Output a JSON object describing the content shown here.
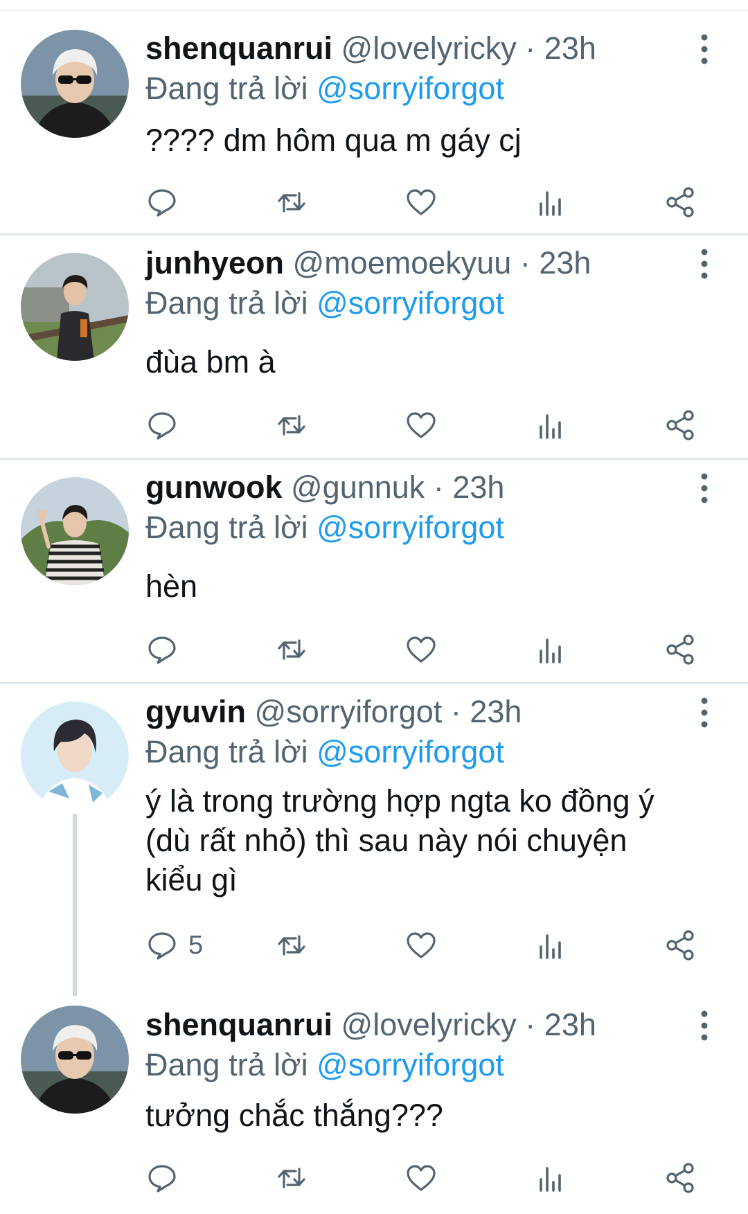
{
  "colors": {
    "text": "#0f1419",
    "secondary": "#536471",
    "accent": "#1d9bf0",
    "divider": "#e1e8ed"
  },
  "replies": [
    {
      "display_name": "shenquanrui",
      "handle": "@lovelyricky",
      "separator": "·",
      "time": "23h",
      "replying_label": "Đang trả lời",
      "replying_to": "@sorryiforgot",
      "text": "???? dm hôm qua m gáy cj",
      "reply_count": "",
      "avatar": "avatar-white-hair-sunglasses"
    },
    {
      "display_name": "junhyeon",
      "handle": "@moemoekyuu",
      "separator": "·",
      "time": "23h",
      "replying_label": "Đang trả lời",
      "replying_to": "@sorryiforgot",
      "text": "đùa bm à",
      "reply_count": "",
      "avatar": "avatar-outdoor-jacket"
    },
    {
      "display_name": "gunwook",
      "handle": "@gunnuk",
      "separator": "·",
      "time": "23h",
      "replying_label": "Đang trả lời",
      "replying_to": "@sorryiforgot",
      "text": "hèn",
      "reply_count": "",
      "avatar": "avatar-striped-sweater-peace-sign"
    },
    {
      "display_name": "gyuvin",
      "handle": "@sorryiforgot",
      "separator": "·",
      "time": "23h",
      "replying_label": "Đang trả lời",
      "replying_to": "@sorryiforgot",
      "text": "ý là trong trường hợp ngta ko đồng ý (dù rất nhỏ) thì sau này nói chuyện kiểu gì",
      "reply_count": "5",
      "avatar": "avatar-light-blue-portrait"
    },
    {
      "display_name": "shenquanrui",
      "handle": "@lovelyricky",
      "separator": "·",
      "time": "23h",
      "replying_label": "Đang trả lời",
      "replying_to": "@sorryiforgot",
      "text": "tưởng chắc thắng???",
      "reply_count": "",
      "avatar": "avatar-white-hair-sunglasses"
    }
  ],
  "icons": {
    "reply": "reply-icon",
    "retweet": "retweet-icon",
    "like": "heart-icon",
    "views": "views-icon",
    "share": "share-icon",
    "more": "more-vertical-icon"
  }
}
